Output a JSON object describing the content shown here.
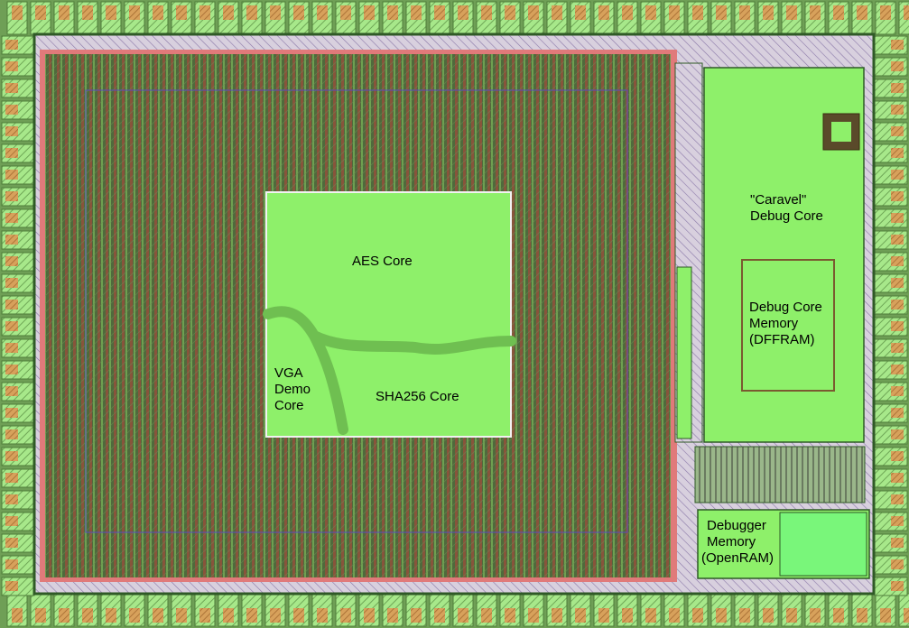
{
  "labels": {
    "aes": "AES Core",
    "sha": "SHA256 Core",
    "vga": [
      "VGA",
      "Demo",
      "Core"
    ],
    "caravel": [
      "\"Caravel\"",
      "Debug Core"
    ],
    "debug_mem": [
      "Debug Core",
      "Memory",
      "(DFFRAM)"
    ],
    "debugger_mem": [
      "Debugger",
      "Memory",
      "(OpenRAM)"
    ]
  },
  "colors": {
    "background": "#1a1a1a",
    "pad_ring": "#6f9f56",
    "pad_light": "#a7e88a",
    "pad_orange": "#d7a15b",
    "core_fill": "#4f6a3c",
    "core_stripe_red": "#b5413a",
    "core_stripe_green": "#87cb63",
    "block_green": "#8ef06a",
    "block_green_bright": "#79f67a",
    "border_pink": "#e07a7a",
    "route_green": "#6fbf51"
  }
}
